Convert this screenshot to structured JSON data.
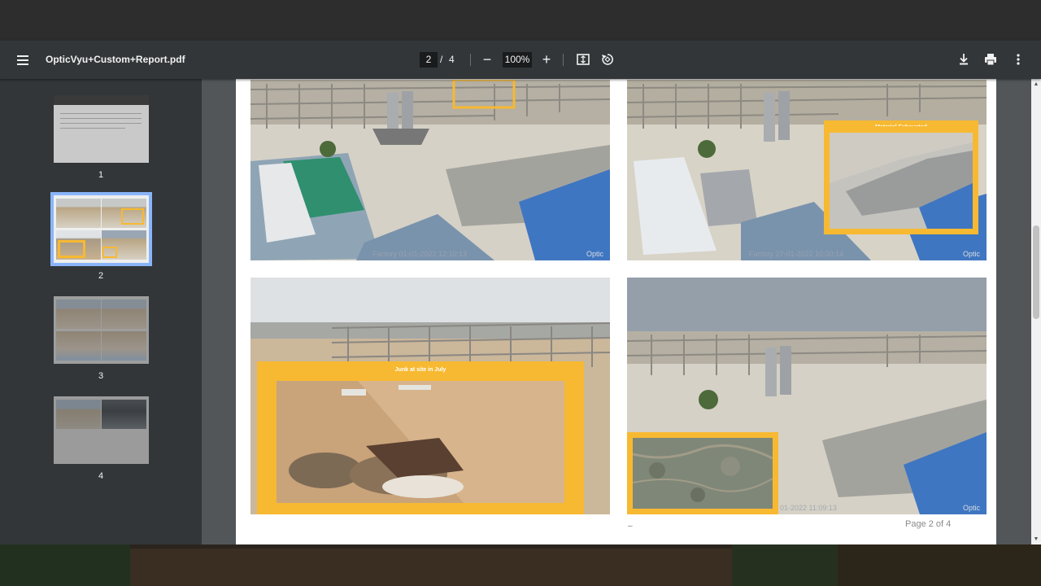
{
  "toolbar": {
    "file_name": "OpticVyu+Custom+Report.pdf",
    "current_page": "2",
    "page_separator": "/",
    "total_pages": "4",
    "zoom_out": "−",
    "zoom_level": "100%",
    "zoom_in": "+",
    "icons": [
      "menu-icon",
      "fit-page-icon",
      "rotate-icon",
      "download-icon",
      "print-icon",
      "more-icon"
    ]
  },
  "sidebar": {
    "thumbnails": [
      {
        "number": "1"
      },
      {
        "number": "2"
      },
      {
        "number": "3"
      },
      {
        "number": "4"
      }
    ]
  },
  "page": {
    "photos": [
      {
        "caption": "Factory 01-01-2022 12:10:13",
        "brand": "Optic"
      },
      {
        "caption": "Factory 27-01-2022 10:30:14",
        "brand": "Optic",
        "overlay_label": "Material Exhausted"
      },
      {
        "caption": "",
        "brand": "",
        "overlay_label": "Junk at site in July"
      },
      {
        "caption": "01-2022 11:09:13",
        "brand": "Optic"
      }
    ],
    "dash": "–",
    "footer": "Page 2 of 4"
  },
  "colors": {
    "toolbar": "#323639",
    "viewer": "#525659",
    "highlight": "#f7b932",
    "selected_thumb": "#8ab4f8"
  }
}
